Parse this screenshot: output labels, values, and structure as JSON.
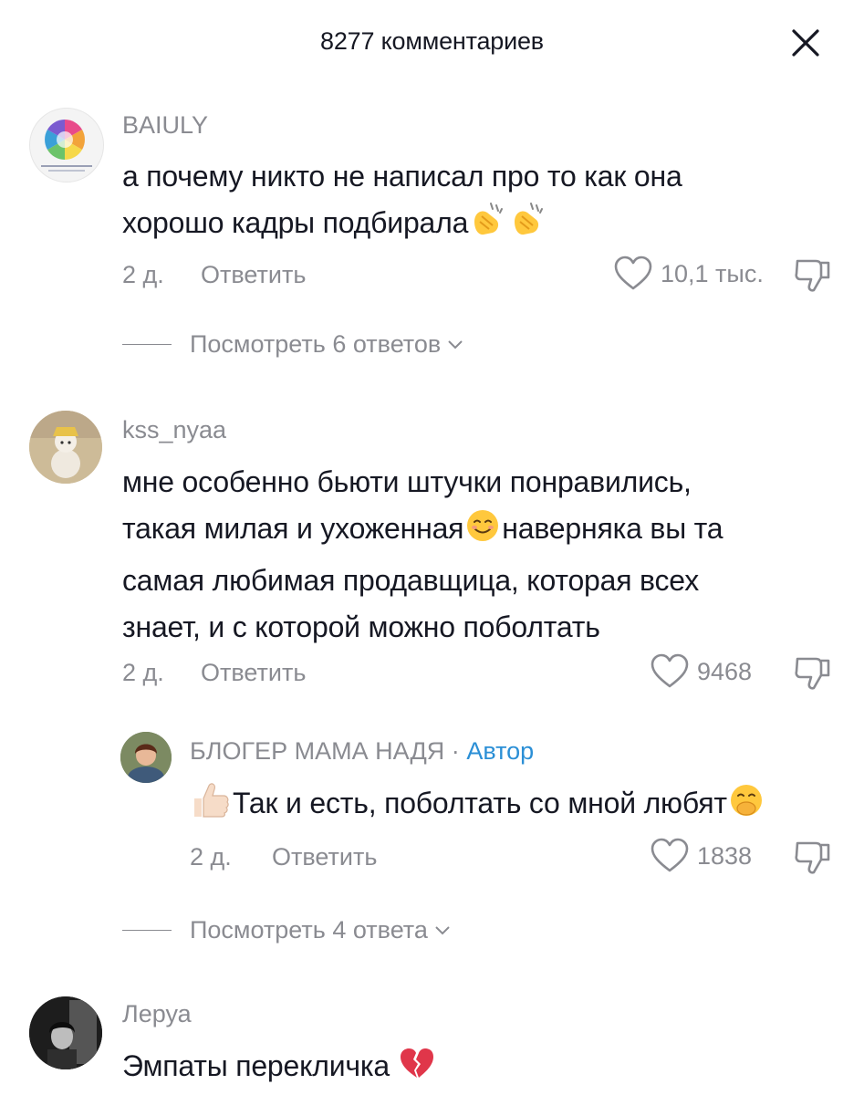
{
  "header": {
    "title": "8277 комментариев"
  },
  "comments": [
    {
      "username": "BAIULY",
      "lines": [
        "а почему никто не написал про то как она",
        "хорошо кадры подбирала"
      ],
      "time": "2 д.",
      "reply_label": "Ответить",
      "likes": "10,1 тыс.",
      "view_replies": "Посмотреть 6 ответов"
    },
    {
      "username": "kss_nyaa",
      "lines": [
        "мне особенно бьюти штучки понравились,",
        "такая милая и ухоженная",
        "наверняка вы та",
        "самая любимая продавщица, которая всех",
        "знает, и с которой можно поболтать"
      ],
      "time": "2 д.",
      "reply_label": "Ответить",
      "likes": "9468",
      "reply": {
        "username": "БЛОГЕР МАМА НАДЯ",
        "separator": "·",
        "badge": "Автор",
        "text": "Так и есть, поболтать со мной любят",
        "time": "2 д.",
        "reply_label": "Ответить",
        "likes": "1838"
      },
      "view_replies": "Посмотреть 4 ответа"
    },
    {
      "username": "Леруа",
      "lines": [
        "Эмпаты перекличка"
      ]
    }
  ],
  "icons": {
    "close": "close-icon",
    "like": "heart-outline-icon",
    "dislike": "thumbs-down-icon",
    "chevron": "chevron-down-icon",
    "clap": "clapping-hands-emoji",
    "smile": "smiling-face-emoji",
    "thumbs_up": "thumbs-up-emoji",
    "giggle": "face-with-hand-over-mouth-emoji",
    "broken_heart": "broken-heart-emoji"
  },
  "colors": {
    "text": "#161823",
    "secondary": "#8a8b91",
    "author_badge": "#2b8fd6"
  }
}
